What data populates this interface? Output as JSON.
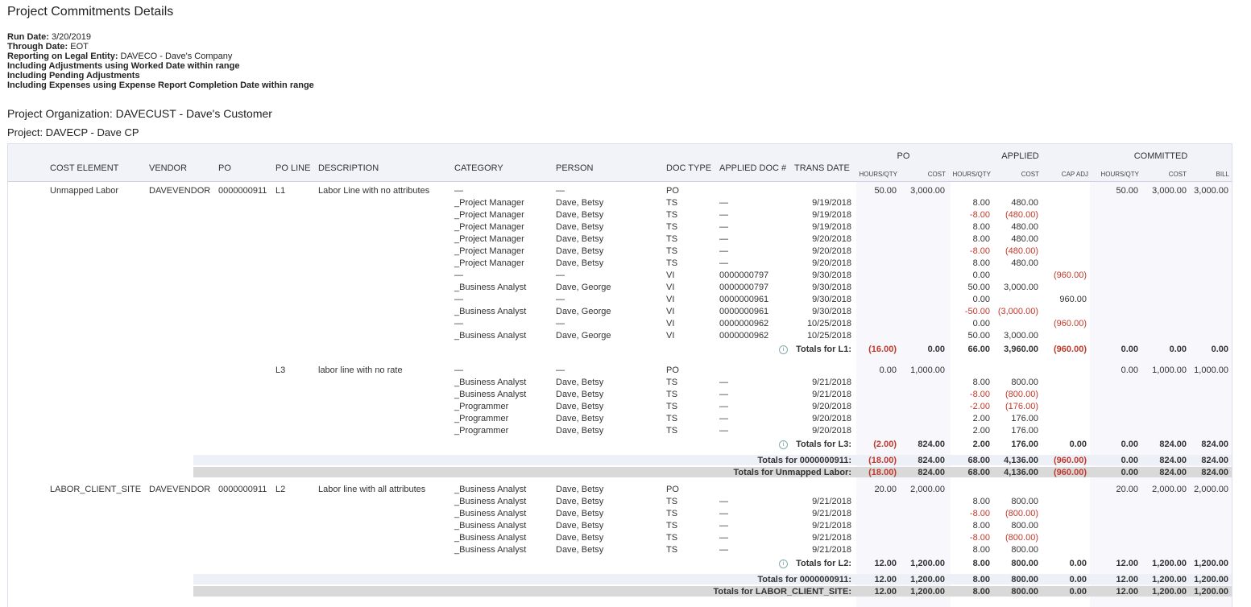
{
  "title": "Project Commitments Details",
  "params": [
    {
      "label": "Run Date:",
      "value": " 3/20/2019"
    },
    {
      "label": "Through Date:",
      "value": " EOT"
    },
    {
      "label": "Reporting on Legal Entity:",
      "value": " DAVECO - Dave's Company"
    },
    {
      "label": "Including Adjustments using Worked Date within range",
      "value": ""
    },
    {
      "label": "Including Pending Adjustments",
      "value": ""
    },
    {
      "label": "Including Expenses using Expense Report Completion Date within range",
      "value": ""
    }
  ],
  "org_label": "Project Organization:  DAVECUST - Dave's Customer",
  "project_label": "Project:  DAVECP - Dave CP",
  "headers": {
    "cost_element": "COST ELEMENT",
    "vendor": "VENDOR",
    "po": "PO",
    "po_line": "PO LINE",
    "description": "DESCRIPTION",
    "category": "CATEGORY",
    "person": "PERSON",
    "doc_type": "DOC TYPE",
    "applied_doc": "APPLIED DOC #",
    "trans_date": "TRANS DATE",
    "group_po": "PO",
    "group_applied": "APPLIED",
    "group_committed": "COMMITTED",
    "hours_qty": "HOURS/QTY",
    "cost": "COST",
    "cap_adj": "CAP ADJ",
    "bill": "BILL"
  },
  "rows": [
    {
      "ce": "Unmapped Labor",
      "vendor": "DAVEVENDOR",
      "po": "0000000911",
      "line": "L1",
      "desc": "Labor Line with no attributes",
      "cat": "—",
      "person": "—",
      "doc": "PO",
      "adoc": "",
      "date": "",
      "poh": "50.00",
      "poc": "3,000.00",
      "aph": "",
      "apc": "",
      "cap": "",
      "coh": "50.00",
      "coc": "3,000.00",
      "bill": "3,000.00"
    },
    {
      "cat": "_Project Manager",
      "person": "Dave, Betsy",
      "doc": "TS",
      "adoc": "—",
      "date": "9/19/2018",
      "aph": "8.00",
      "apc": "480.00"
    },
    {
      "cat": "_Project Manager",
      "person": "Dave, Betsy",
      "doc": "TS",
      "adoc": "—",
      "date": "9/19/2018",
      "aph": "-8.00",
      "apc": "(480.00)"
    },
    {
      "cat": "_Project Manager",
      "person": "Dave, Betsy",
      "doc": "TS",
      "adoc": "—",
      "date": "9/19/2018",
      "aph": "8.00",
      "apc": "480.00"
    },
    {
      "cat": "_Project Manager",
      "person": "Dave, Betsy",
      "doc": "TS",
      "adoc": "—",
      "date": "9/20/2018",
      "aph": "8.00",
      "apc": "480.00"
    },
    {
      "cat": "_Project Manager",
      "person": "Dave, Betsy",
      "doc": "TS",
      "adoc": "—",
      "date": "9/20/2018",
      "aph": "-8.00",
      "apc": "(480.00)"
    },
    {
      "cat": "_Project Manager",
      "person": "Dave, Betsy",
      "doc": "TS",
      "adoc": "—",
      "date": "9/20/2018",
      "aph": "8.00",
      "apc": "480.00"
    },
    {
      "cat": "—",
      "person": "—",
      "doc": "VI",
      "adoc": "0000000797",
      "date": "9/30/2018",
      "aph": "0.00",
      "cap": "(960.00)"
    },
    {
      "cat": "_Business Analyst",
      "person": "Dave, George",
      "doc": "VI",
      "adoc": "0000000797",
      "date": "9/30/2018",
      "aph": "50.00",
      "apc": "3,000.00"
    },
    {
      "cat": "—",
      "person": "—",
      "doc": "VI",
      "adoc": "0000000961",
      "date": "9/30/2018",
      "aph": "0.00",
      "cap": "960.00"
    },
    {
      "cat": "_Business Analyst",
      "person": "Dave, George",
      "doc": "VI",
      "adoc": "0000000961",
      "date": "9/30/2018",
      "aph": "-50.00",
      "apc": "(3,000.00)"
    },
    {
      "cat": "—",
      "person": "—",
      "doc": "VI",
      "adoc": "0000000962",
      "date": "10/25/2018",
      "aph": "0.00",
      "cap": "(960.00)"
    },
    {
      "cat": "_Business Analyst",
      "person": "Dave, George",
      "doc": "VI",
      "adoc": "0000000962",
      "date": "10/25/2018",
      "aph": "50.00",
      "apc": "3,000.00"
    }
  ],
  "total_l1": {
    "label": "Totals for L1:",
    "poh": "(16.00)",
    "poc": "0.00",
    "aph": "66.00",
    "apc": "3,960.00",
    "cap": "(960.00)",
    "coh": "0.00",
    "coc": "0.00",
    "bill": "0.00"
  },
  "rows_l3": [
    {
      "line": "L3",
      "desc": "labor line with no rate",
      "cat": "—",
      "person": "—",
      "doc": "PO",
      "poh": "0.00",
      "poc": "1,000.00",
      "coh": "0.00",
      "coc": "1,000.00",
      "bill": "1,000.00"
    },
    {
      "cat": "_Business Analyst",
      "person": "Dave, Betsy",
      "doc": "TS",
      "adoc": "—",
      "date": "9/21/2018",
      "aph": "8.00",
      "apc": "800.00"
    },
    {
      "cat": "_Business Analyst",
      "person": "Dave, Betsy",
      "doc": "TS",
      "adoc": "—",
      "date": "9/21/2018",
      "aph": "-8.00",
      "apc": "(800.00)"
    },
    {
      "cat": "_Programmer",
      "person": "Dave, Betsy",
      "doc": "TS",
      "adoc": "—",
      "date": "9/20/2018",
      "aph": "-2.00",
      "apc": "(176.00)"
    },
    {
      "cat": "_Programmer",
      "person": "Dave, Betsy",
      "doc": "TS",
      "adoc": "—",
      "date": "9/20/2018",
      "aph": "2.00",
      "apc": "176.00"
    },
    {
      "cat": "_Programmer",
      "person": "Dave, Betsy",
      "doc": "TS",
      "adoc": "—",
      "date": "9/20/2018",
      "aph": "2.00",
      "apc": "176.00"
    }
  ],
  "total_l3": {
    "label": "Totals for L3:",
    "poh": "(2.00)",
    "poc": "824.00",
    "aph": "2.00",
    "apc": "176.00",
    "cap": "0.00",
    "coh": "0.00",
    "coc": "824.00",
    "bill": "824.00"
  },
  "total_po_911a": {
    "label": "Totals for 0000000911:",
    "poh": "(18.00)",
    "poc": "824.00",
    "aph": "68.00",
    "apc": "4,136.00",
    "cap": "(960.00)",
    "coh": "0.00",
    "coc": "824.00",
    "bill": "824.00"
  },
  "total_unmapped": {
    "label": "Totals for Unmapped Labor:",
    "poh": "(18.00)",
    "poc": "824.00",
    "aph": "68.00",
    "apc": "4,136.00",
    "cap": "(960.00)",
    "coh": "0.00",
    "coc": "824.00",
    "bill": "824.00"
  },
  "rows_l2": [
    {
      "ce": "LABOR_CLIENT_SITE",
      "vendor": "DAVEVENDOR",
      "po": "0000000911",
      "line": "L2",
      "desc": "Labor line with all attributes",
      "cat": "_Business Analyst",
      "person": "Dave, Betsy",
      "doc": "PO",
      "poh": "20.00",
      "poc": "2,000.00",
      "coh": "20.00",
      "coc": "2,000.00",
      "bill": "2,000.00"
    },
    {
      "cat": "_Business Analyst",
      "person": "Dave, Betsy",
      "doc": "TS",
      "adoc": "—",
      "date": "9/21/2018",
      "aph": "8.00",
      "apc": "800.00"
    },
    {
      "cat": "_Business Analyst",
      "person": "Dave, Betsy",
      "doc": "TS",
      "adoc": "—",
      "date": "9/21/2018",
      "aph": "-8.00",
      "apc": "(800.00)"
    },
    {
      "cat": "_Business Analyst",
      "person": "Dave, Betsy",
      "doc": "TS",
      "adoc": "—",
      "date": "9/21/2018",
      "aph": "8.00",
      "apc": "800.00"
    },
    {
      "cat": "_Business Analyst",
      "person": "Dave, Betsy",
      "doc": "TS",
      "adoc": "—",
      "date": "9/21/2018",
      "aph": "-8.00",
      "apc": "(800.00)"
    },
    {
      "cat": "_Business Analyst",
      "person": "Dave, Betsy",
      "doc": "TS",
      "adoc": "—",
      "date": "9/21/2018",
      "aph": "8.00",
      "apc": "800.00"
    }
  ],
  "total_l2": {
    "label": "Totals for L2:",
    "poh": "12.00",
    "poc": "1,200.00",
    "aph": "8.00",
    "apc": "800.00",
    "cap": "0.00",
    "coh": "12.00",
    "coc": "1,200.00",
    "bill": "1,200.00"
  },
  "total_po_911b": {
    "label": "Totals for 0000000911:",
    "poh": "12.00",
    "poc": "1,200.00",
    "aph": "8.00",
    "apc": "800.00",
    "cap": "0.00",
    "coh": "12.00",
    "coc": "1,200.00",
    "bill": "1,200.00"
  },
  "total_labor_client": {
    "label": "Totals for LABOR_CLIENT_SITE:",
    "poh": "12.00",
    "poc": "1,200.00",
    "aph": "8.00",
    "apc": "800.00",
    "cap": "0.00",
    "coh": "12.00",
    "coc": "1,200.00",
    "bill": "1,200.00"
  }
}
